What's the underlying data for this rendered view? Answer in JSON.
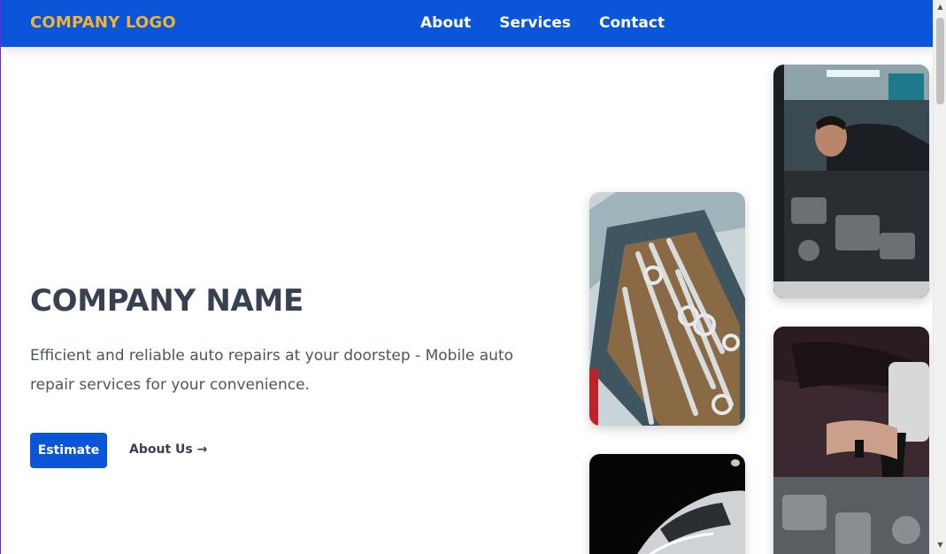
{
  "nav": {
    "logo": "COMPANY LOGO",
    "links": [
      "About",
      "Services",
      "Contact"
    ]
  },
  "hero": {
    "title": "COMPANY NAME",
    "description": "Efficient and reliable auto repairs at your doorstep - Mobile auto repair services for your convenience.",
    "primary_button": "Estimate",
    "secondary_link": "About Us →"
  },
  "colors": {
    "brand_blue": "#0b55d9",
    "logo_gold": "#f1b42f",
    "text_dark": "#374151"
  },
  "icons": {
    "scroll_up": "triangle-up-icon",
    "scroll_down": "triangle-down-icon"
  }
}
